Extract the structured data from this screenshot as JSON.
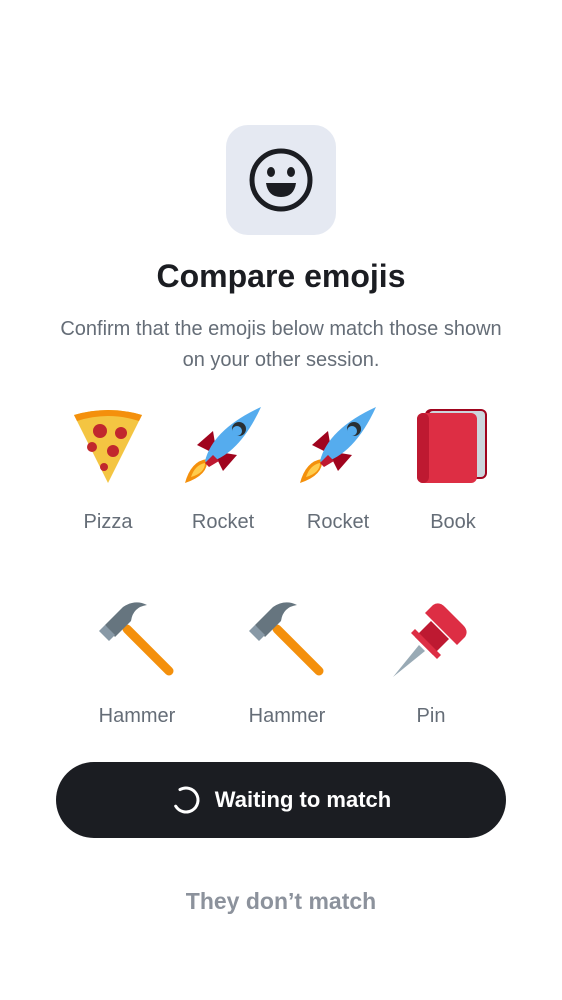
{
  "header": {
    "icon": "smiley-face-icon",
    "title": "Compare emojis",
    "subtitle": "Confirm that the emojis below match those shown on your other session."
  },
  "emojis": {
    "row1": [
      {
        "label": "Pizza",
        "icon": "pizza-icon"
      },
      {
        "label": "Rocket",
        "icon": "rocket-icon"
      },
      {
        "label": "Rocket",
        "icon": "rocket-icon"
      },
      {
        "label": "Book",
        "icon": "book-icon"
      }
    ],
    "row2": [
      {
        "label": "Hammer",
        "icon": "hammer-icon"
      },
      {
        "label": "Hammer",
        "icon": "hammer-icon"
      },
      {
        "label": "Pin",
        "icon": "pushpin-icon"
      }
    ]
  },
  "actions": {
    "primary_label": "Waiting to match",
    "primary_icon": "spinner-icon",
    "secondary_label": "They don’t match"
  },
  "colors": {
    "primary_bg": "#1b1d22",
    "icon_tile_bg": "#e5e9f2",
    "muted_text": "#656d77"
  }
}
